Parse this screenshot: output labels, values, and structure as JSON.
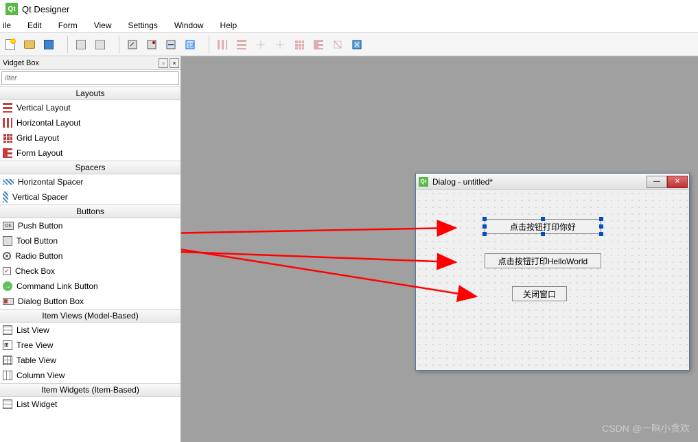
{
  "app": {
    "title": "Qt Designer"
  },
  "menu": {
    "file": "ile",
    "edit": "Edit",
    "form": "Form",
    "view": "View",
    "settings": "Settings",
    "window": "Window",
    "help": "Help"
  },
  "sidebar": {
    "title": "Vidget Box",
    "filter_placeholder": "ilter",
    "categories": {
      "layouts": "Layouts",
      "spacers": "Spacers",
      "buttons": "Buttons",
      "itemviews": "Item Views (Model-Based)",
      "itemwidgets": "Item Widgets (Item-Based)"
    },
    "items": {
      "vertical_layout": "Vertical Layout",
      "horizontal_layout": "Horizontal Layout",
      "grid_layout": "Grid Layout",
      "form_layout": "Form Layout",
      "horizontal_spacer": "Horizontal Spacer",
      "vertical_spacer": "Vertical Spacer",
      "push_button": "Push Button",
      "tool_button": "Tool Button",
      "radio_button": "Radio Button",
      "check_box": "Check Box",
      "command_link_button": "Command Link Button",
      "dialog_button_box": "Dialog Button Box",
      "list_view": "List View",
      "tree_view": "Tree View",
      "table_view": "Table View",
      "column_view": "Column View",
      "list_widget": "List Widget"
    }
  },
  "dialog": {
    "title": "Dialog - untitled*",
    "btn1": "点击按钮打印你好",
    "btn2": "点击按钮打印HelloWorld",
    "btn3": "关闭窗口"
  },
  "watermark": "CSDN @一晌小贪欢"
}
